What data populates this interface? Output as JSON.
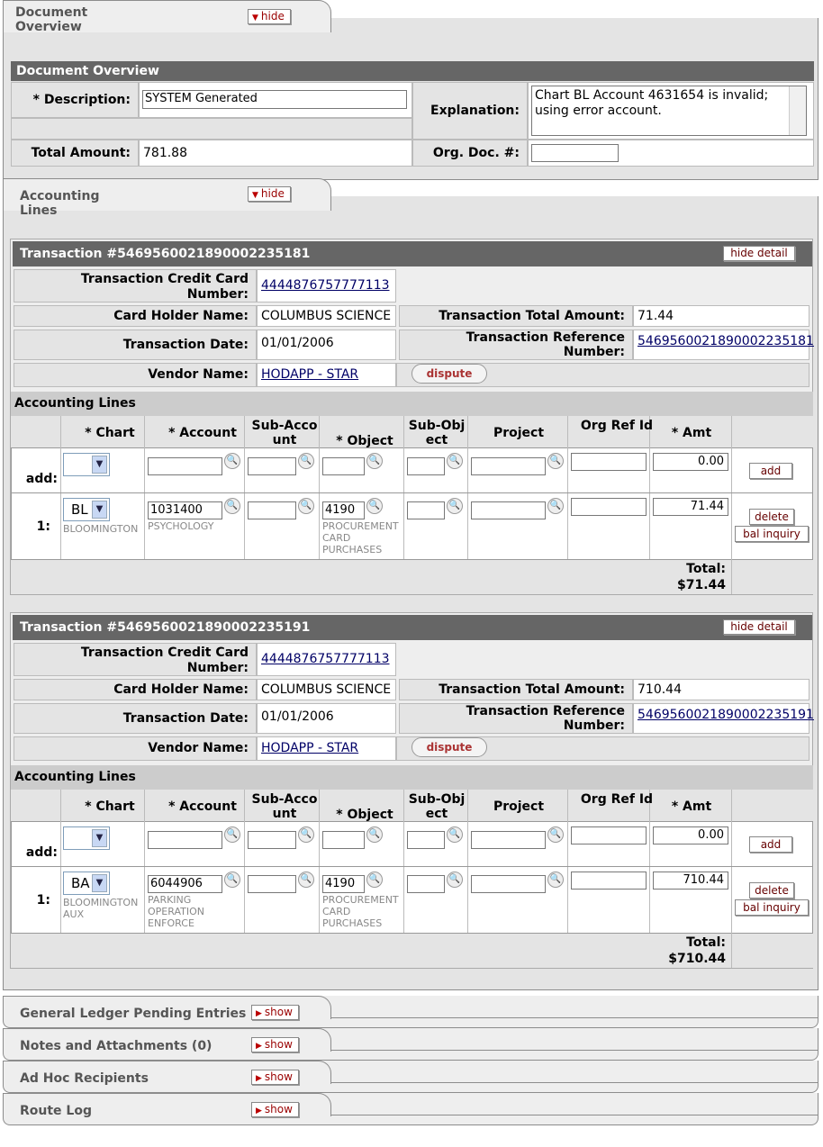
{
  "doc_overview_tab": {
    "title": "Document Overview",
    "hide": "hide"
  },
  "doc_overview": {
    "header": "Document Overview",
    "description_label": "* Description:",
    "description_value": "SYSTEM Generated",
    "explanation_label": "Explanation:",
    "explanation_value": "Chart BL Account 4631654 is invalid; using error account.",
    "total_amount_label": "Total Amount:",
    "total_amount_value": "781.88",
    "org_doc_label": "Org. Doc. #:",
    "org_doc_value": ""
  },
  "acct_tab": {
    "title": "Accounting Lines",
    "hide": "hide"
  },
  "labels": {
    "cc_number": "Transaction Credit Card Number:",
    "holder": "Card Holder Name:",
    "total": "Transaction Total Amount:",
    "date": "Transaction Date:",
    "ref": "Transaction Reference Number:",
    "vendor": "Vendor Name:",
    "hide_detail": "hide detail",
    "dispute": "dispute",
    "acct_lines": "Accounting Lines",
    "col_chart": "* Chart",
    "col_account": "* Account",
    "col_subaccount": "Sub-Account",
    "col_object": "* Object",
    "col_subobject": "Sub-Object",
    "col_project": "Project",
    "col_orgref": "Org Ref Id",
    "col_amt": "* Amt",
    "add_row": "add:",
    "add_btn": "add",
    "delete_btn": "delete",
    "bal_btn": "bal inquiry",
    "total_label": "Total:"
  },
  "transactions": [
    {
      "title": "Transaction #5469560021890002235181",
      "cc_number": "4444876757777113",
      "holder": "COLUMBUS SCIENCE",
      "total": "71.44",
      "date": "01/01/2006",
      "ref": "5469560021890002235181",
      "vendor": "HODAPP - STAR",
      "add_amt": "0.00",
      "line": {
        "num": "1:",
        "chart": "BL",
        "chart_name": "BLOOMINGTON",
        "account": "1031400",
        "account_name": "PSYCHOLOGY",
        "object": "4190",
        "object_name": "PROCUREMENT CARD PURCHASES",
        "amt": "71.44"
      },
      "sum": "$71.44"
    },
    {
      "title": "Transaction #5469560021890002235191",
      "cc_number": "4444876757777113",
      "holder": "COLUMBUS SCIENCE",
      "total": "710.44",
      "date": "01/01/2006",
      "ref": "5469560021890002235191",
      "vendor": "HODAPP - STAR",
      "add_amt": "0.00",
      "line": {
        "num": "1:",
        "chart": "BA",
        "chart_name": "BLOOMINGTON AUX",
        "account": "6044906",
        "account_name": "PARKING OPERATION ENFORCE",
        "object": "4190",
        "object_name": "PROCUREMENT CARD PURCHASES",
        "amt": "710.44"
      },
      "sum": "$710.44"
    }
  ],
  "bottom_tabs": [
    {
      "title": "General Ledger Pending Entries",
      "show": "show"
    },
    {
      "title": "Notes and Attachments (0)",
      "show": "show"
    },
    {
      "title": "Ad Hoc Recipients",
      "show": "show"
    },
    {
      "title": "Route Log",
      "show": "show"
    }
  ]
}
